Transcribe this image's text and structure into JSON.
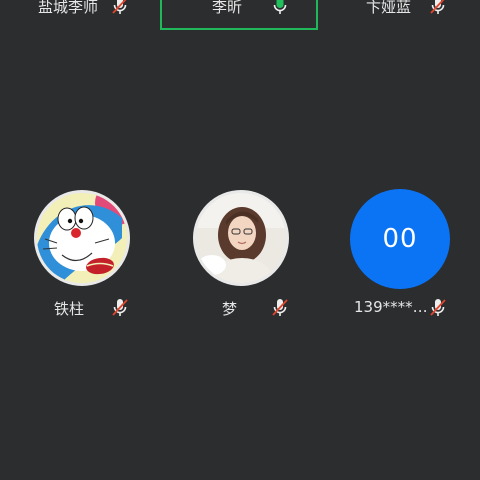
{
  "top_participants": [
    {
      "name": "盐城李师",
      "mic": "muted"
    },
    {
      "name": "李昕",
      "mic": "speaking"
    },
    {
      "name": "卞娅蓝",
      "mic": "muted"
    }
  ],
  "participants": [
    {
      "name": "铁柱",
      "mic": "muted",
      "avatar": "doraemon-image"
    },
    {
      "name": "梦",
      "mic": "muted",
      "avatar": "photo"
    },
    {
      "name": "139****…",
      "mic": "muted",
      "avatar_text": "00"
    }
  ],
  "colors": {
    "background": "#2b2d2f",
    "speaking_frame": "#1fb85a",
    "speaking_mic": "#20c05c",
    "muted_slash": "#e0452d",
    "avatar_blue": "#0b74f5"
  }
}
